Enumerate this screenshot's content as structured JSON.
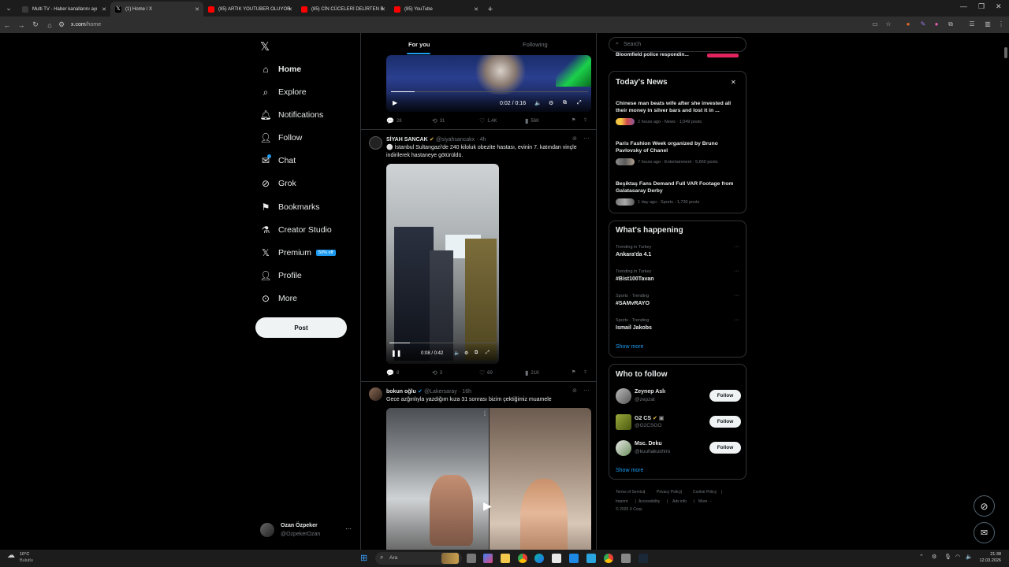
{
  "browser": {
    "tabs": [
      {
        "title": "Multi TV - Haber kanallarını ayı",
        "fav": "#3a3a3a"
      },
      {
        "title": "(1) Home / X",
        "fav": "#000000"
      },
      {
        "title": "(85) ARTIK YOUTUBER OLUYOR",
        "fav": "#ff0000"
      },
      {
        "title": "(85) CİN CÜCELERİ DELİRTEN B",
        "fav": "#ff0000"
      },
      {
        "title": "(85) YouTube",
        "fav": "#ff0000"
      }
    ],
    "url_domain": "x.com",
    "url_path": "/home"
  },
  "nav": {
    "items": [
      {
        "label": "Home",
        "icon": "home-icon"
      },
      {
        "label": "Explore",
        "icon": "search-icon"
      },
      {
        "label": "Notifications",
        "icon": "bell-icon"
      },
      {
        "label": "Follow",
        "icon": "person-add-icon"
      },
      {
        "label": "Chat",
        "icon": "mail-icon"
      },
      {
        "label": "Grok",
        "icon": "grok-icon"
      },
      {
        "label": "Bookmarks",
        "icon": "bookmark-icon"
      },
      {
        "label": "Creator Studio",
        "icon": "flask-icon"
      },
      {
        "label": "Premium",
        "icon": "x-logo-icon"
      },
      {
        "label": "Profile",
        "icon": "person-icon"
      },
      {
        "label": "More",
        "icon": "more-circle-icon"
      }
    ],
    "premium_badge": "50% off",
    "post_label": "Post",
    "account_name": "Ozan Özpeker",
    "account_handle": "@OzpekerOzan"
  },
  "feed": {
    "tab_for_you": "For you",
    "tab_following": "Following",
    "tweet0": {
      "video_time": "0:02 / 0:16",
      "replies": "28",
      "reposts": "31",
      "likes": "1.4K",
      "views": "56K"
    },
    "tweet1": {
      "name": "SİYAH SANCAK",
      "handle": "@siyahsancakx",
      "time": "· 4h",
      "text": "⚪ İstanbul Sultangazi'de 240 kiloluk obezite hastası, evinin 7. katından vinçle indirilerek hastaneye götürüldü.",
      "video_time": "0:08 / 0:42",
      "replies": "8",
      "reposts": "3",
      "likes": "69",
      "views": "21K"
    },
    "tweet2": {
      "name": "bokun oğlu",
      "handle": "@Lakersaray",
      "time": "· 16h",
      "text": "Gece azğınlıyla yazdığım kıza 31 sonrası bizim çektiğimiz muamele"
    }
  },
  "right": {
    "search_placeholder": "Search",
    "top_snippet": "Bloomfield police respondin...",
    "todays_news": {
      "title": "Today's News",
      "items": [
        {
          "title": "Chinese man beats wife after she invested all their money in silver bars and lost it in ...",
          "meta": "2 hours ago · News · 1,049 posts"
        },
        {
          "title": "Paris Fashion Week organized by Bruno Pavlovsky of Chanel",
          "meta": "7 hours ago · Entertainment · 5,660 posts"
        },
        {
          "title": "Beşiktaş Fans Demand Full VAR Footage from Galatasaray Derby",
          "meta": "1 day ago · Sports · 1,730 posts"
        }
      ]
    },
    "whats_happening": {
      "title": "What's happening",
      "trends": [
        {
          "context": "Trending in Turkey",
          "name": "Ankara'da 4.1"
        },
        {
          "context": "Trending in Turkey",
          "name": "#Bist100Tavan"
        },
        {
          "context": "Sports · Trending",
          "name": "#SAMvRAYO"
        },
        {
          "context": "Sports · Trending",
          "name": "Ismail Jakobs"
        }
      ],
      "show_more": "Show more"
    },
    "who_to_follow": {
      "title": "Who to follow",
      "users": [
        {
          "name": "Zeynep Aslı",
          "handle": "@zepzat"
        },
        {
          "name": "G2 CS",
          "handle": "@G2CSGO"
        },
        {
          "name": "Msc. Deku",
          "handle": "@kuuhakushiro"
        }
      ],
      "follow_label": "Follow",
      "show_more": "Show more"
    },
    "footer": {
      "links": [
        "Terms of Service",
        "|",
        "Privacy Policy",
        "|",
        "Cookie Policy",
        "|",
        "Imprint",
        "|",
        "Accessibility",
        "|",
        "Ads info",
        "|",
        "More ···"
      ],
      "copyright": "© 2026 X Corp."
    }
  },
  "taskbar": {
    "weather_temp": "10°C",
    "weather_desc": "Bulutlu",
    "search_label": "Ara",
    "time": "21:38",
    "date": "12.03.2026"
  }
}
